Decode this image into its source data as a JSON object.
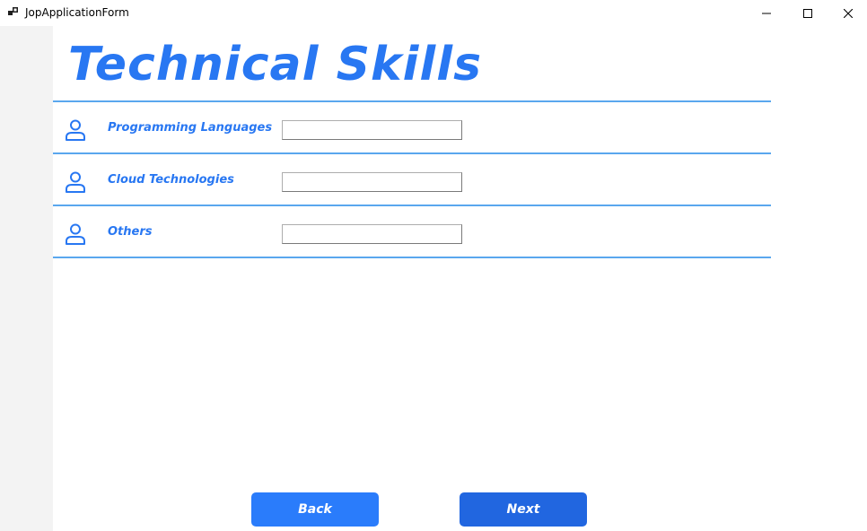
{
  "window": {
    "title": "JopApplicationForm",
    "icon": "app-window-icon",
    "controls": [
      "minimize-icon",
      "maximize-icon",
      "close-icon"
    ]
  },
  "page": {
    "title": "Technical Skills"
  },
  "fields": [
    {
      "label": "Programming Languages",
      "value": "",
      "icon": "user-icon"
    },
    {
      "label": "Cloud Technologies",
      "value": "",
      "icon": "user-icon"
    },
    {
      "label": "Others",
      "value": "",
      "icon": "user-icon"
    }
  ],
  "buttons": {
    "back": "Back",
    "next": "Next"
  },
  "colors": {
    "accent": "#2877f2",
    "divider": "#5aa7ee",
    "back_button": "#2a7cfb",
    "next_button": "#2166e0",
    "sidebar": "#f3f3f3"
  }
}
